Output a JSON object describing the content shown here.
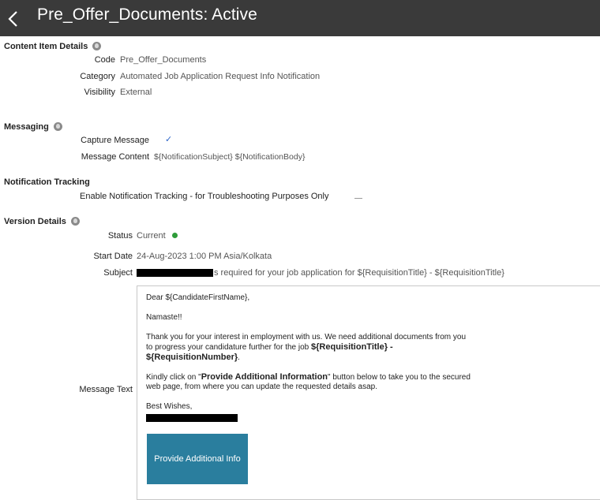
{
  "header": {
    "title": "Pre_Offer_Documents: Active"
  },
  "content_item": {
    "heading": "Content Item Details",
    "code_label": "Code",
    "code_value": "Pre_Offer_Documents",
    "category_label": "Category",
    "category_value": "Automated Job Application Request Info Notification",
    "visibility_label": "Visibility",
    "visibility_value": "External"
  },
  "messaging": {
    "heading": "Messaging",
    "capture_label": "Capture Message",
    "capture_value": "✓",
    "content_label": "Message Content",
    "content_value": "${NotificationSubject} ${NotificationBody}"
  },
  "tracking": {
    "heading": "Notification Tracking",
    "enable_label": "Enable Notification Tracking - for Troubleshooting Purposes Only"
  },
  "version": {
    "heading": "Version Details",
    "status_label": "Status",
    "status_value": "Current",
    "start_label": "Start Date",
    "start_value": "24-Aug-2023 1:00 PM Asia/Kolkata",
    "subject_label": "Subject",
    "subject_value": "s required for your job application for ${RequisitionTitle} - ${RequisitionTitle}",
    "message_label": "Message Text"
  },
  "message": {
    "greeting": "Dear ${CandidateFirstName},",
    "salutation": "Namaste!!",
    "line1": "Thank you for your interest in employment with us. We need additional documents from you",
    "line2_prefix": "to progress  your candidature further for the job ",
    "line2_bold": "${RequisitionTitle} -",
    "line3_bold": "${RequisitionNumber}",
    "line3_suffix": ".",
    "line4_prefix": "Kindly click on \"",
    "line4_bold": "Provide Additional Information",
    "line4_suffix": "\" button below to take you to the secured",
    "line5": "web page, from where you can update the requested details asap.",
    "signoff": "Best Wishes,",
    "button_label": "Provide Additional Info"
  },
  "colors": {
    "titlebar": "#3a3a3a",
    "status_dot": "#2e9c3a",
    "check": "#2b64c8",
    "cta": "#2a7e9e"
  }
}
